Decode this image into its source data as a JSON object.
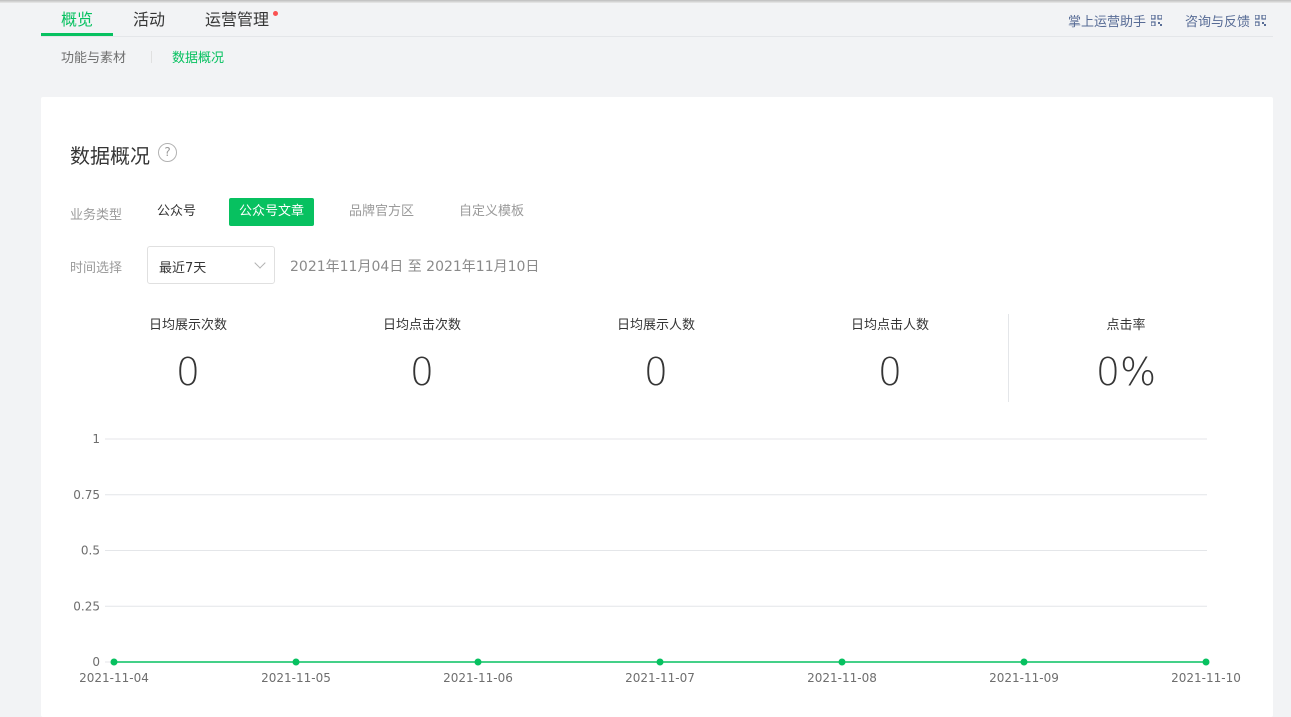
{
  "nav": {
    "tabs": [
      "概览",
      "活动",
      "运营管理"
    ],
    "links": [
      "掌上运营助手",
      "咨询与反馈"
    ]
  },
  "subnav": {
    "items": [
      "功能与素材",
      "数据概况"
    ]
  },
  "card": {
    "title": "数据概况",
    "help": "?",
    "biz_label": "业务类型",
    "biz_types": [
      "公众号",
      "公众号文章",
      "品牌官方区",
      "自定义模板"
    ],
    "time_label": "时间选择",
    "time_select": "最近7天",
    "range": "2021年11月04日 至 2021年11月10日",
    "stats": [
      {
        "label": "日均展示次数",
        "value": "0"
      },
      {
        "label": "日均点击次数",
        "value": "0"
      },
      {
        "label": "日均展示人数",
        "value": "0"
      },
      {
        "label": "日均点击人数",
        "value": "0"
      },
      {
        "label": "点击率",
        "value": "0%"
      }
    ]
  },
  "colors": {
    "accent": "#07c160",
    "badge": "#fa5151",
    "link": "#576b95"
  },
  "chart_data": {
    "type": "line",
    "x": [
      "2021-11-04",
      "2021-11-05",
      "2021-11-06",
      "2021-11-07",
      "2021-11-08",
      "2021-11-09",
      "2021-11-10"
    ],
    "series": [
      {
        "values": [
          0,
          0,
          0,
          0,
          0,
          0,
          0
        ]
      }
    ],
    "ylim": [
      0,
      1
    ],
    "yticks": [
      "0",
      "0.25",
      "0.5",
      "0.75",
      "1"
    ],
    "grid": true
  }
}
